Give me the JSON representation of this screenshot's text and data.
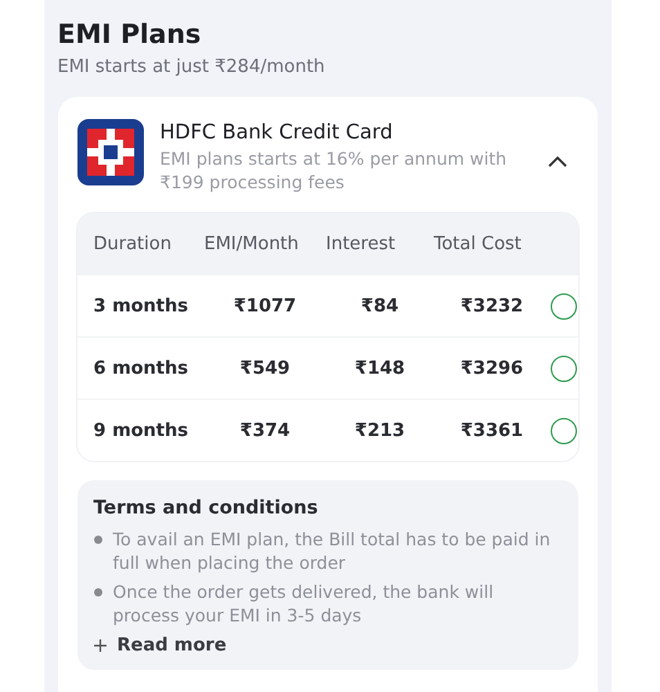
{
  "header": {
    "title": "EMI Plans",
    "subtitle": "EMI starts at just ₹284/month"
  },
  "bank": {
    "name": "HDFC Bank Credit Card",
    "description": "EMI plans starts at 16% per annum with ₹199 processing fees",
    "expanded": true
  },
  "table": {
    "columns": [
      "Duration",
      "EMI/Month",
      "Interest",
      "Total Cost"
    ],
    "rows": [
      {
        "cells": [
          "3 months",
          "₹1077",
          "₹84",
          "₹3232"
        ],
        "selected": false
      },
      {
        "cells": [
          "6 months",
          "₹549",
          "₹148",
          "₹3296"
        ],
        "selected": false
      },
      {
        "cells": [
          "9 months",
          "₹374",
          "₹213",
          "₹3361"
        ],
        "selected": false
      }
    ]
  },
  "terms": {
    "title": "Terms and conditions",
    "items": [
      "To avail an EMI plan, the Bill total has to be paid in full when placing the order",
      "Once the order gets delivered, the bank will process your EMI in 3-5 days"
    ],
    "link": "Read more"
  }
}
